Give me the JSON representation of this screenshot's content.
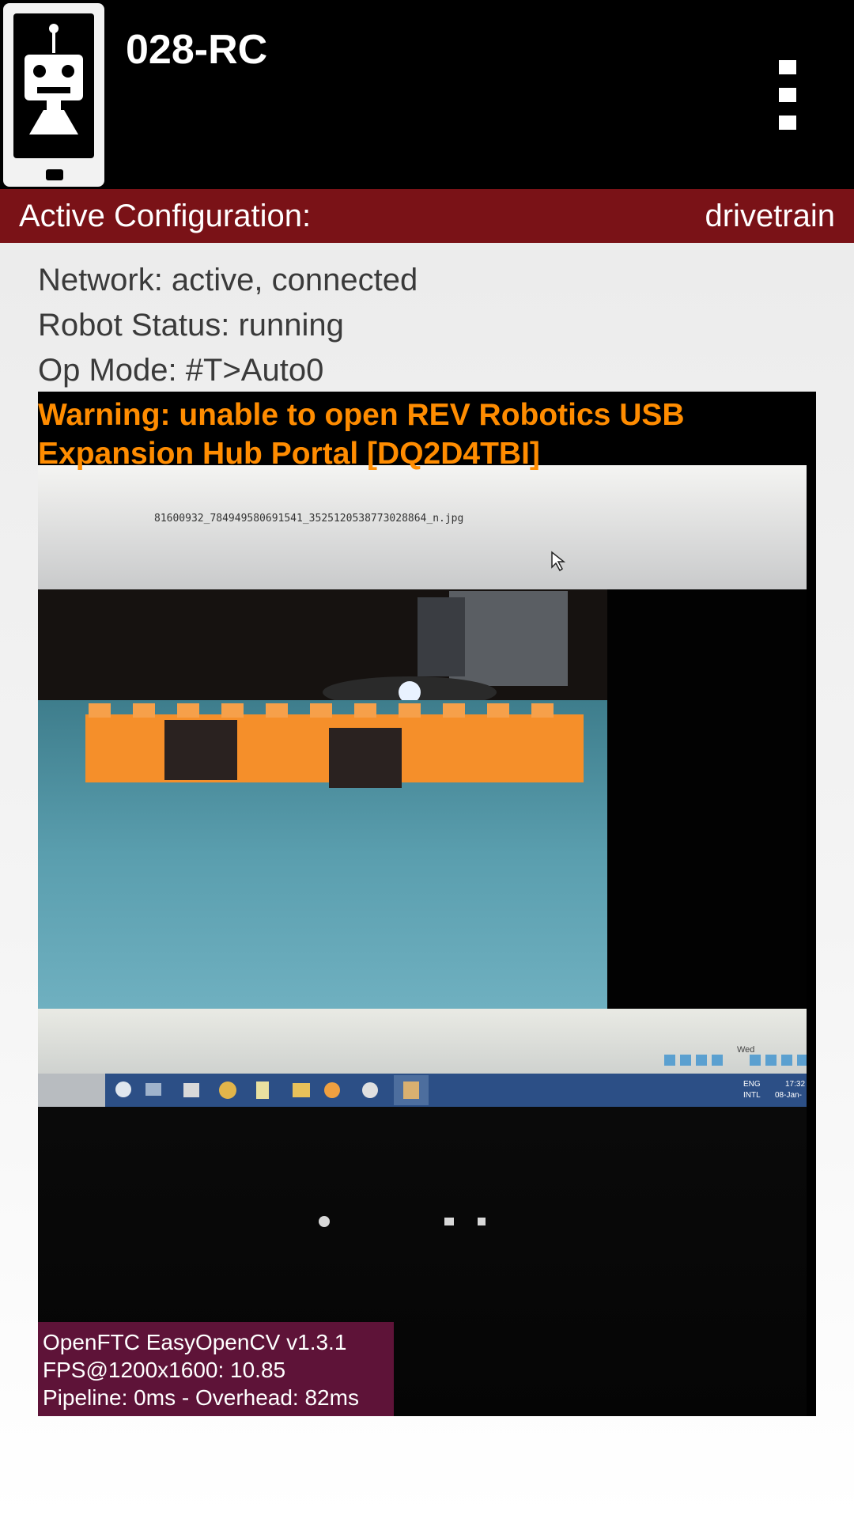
{
  "app_bar": {
    "title": "028-RC",
    "app_icon": "robot-phone-icon",
    "overflow_icon": "more-vert-icon"
  },
  "config": {
    "label": "Active Configuration:",
    "value": "drivetrain"
  },
  "status": {
    "network": "Network: active, connected",
    "robot_status": "Robot Status: running",
    "op_mode": "Op Mode: #T>Auto0"
  },
  "camera": {
    "warning": "Warning: unable to open REV Robotics USB Expansion Hub Portal [DQ2D4TBI]",
    "filename": "81600932_784949580691541_3525120538773028864_n.jpg",
    "tray_lang": "ENG",
    "tray_layout": "INTL",
    "tray_time": "17:32",
    "tray_date": "08-Jan-",
    "tray_day": "Wed",
    "stats": {
      "line1": "OpenFTC EasyOpenCV v1.3.1",
      "line2": "FPS@1200x1600: 10.85",
      "line3": "Pipeline: 0ms - Overhead: 82ms"
    }
  },
  "colors": {
    "app_bar": "#000000",
    "config_bar": "#7a1217",
    "warning_text": "#ff8c00",
    "stats_box": "#5e1338",
    "status_text": "#3a3a3a"
  }
}
